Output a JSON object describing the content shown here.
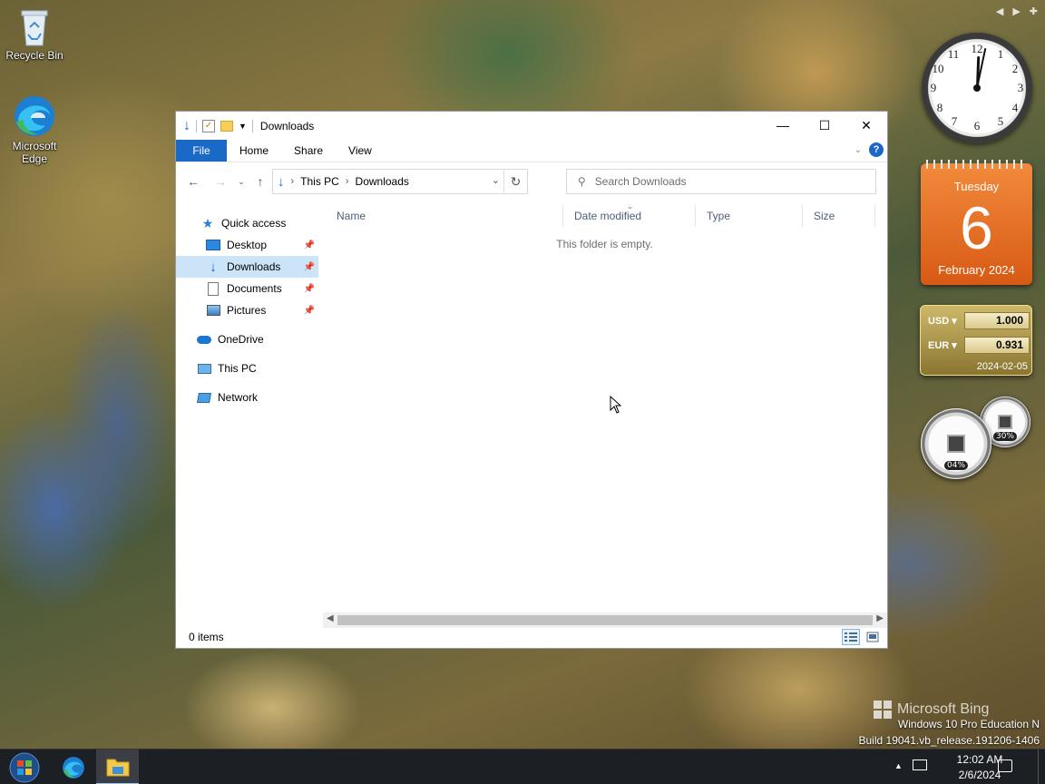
{
  "desktop": {
    "icons": [
      {
        "label": "Recycle Bin",
        "icon": "recycle-bin-icon"
      },
      {
        "label": "Microsoft Edge",
        "icon": "edge-icon"
      }
    ]
  },
  "explorer": {
    "title": "Downloads",
    "ribbon_tabs": [
      "File",
      "Home",
      "Share",
      "View"
    ],
    "address": {
      "crumbs": [
        "This PC",
        "Downloads"
      ]
    },
    "search": {
      "placeholder": "Search Downloads"
    },
    "nav": {
      "quick_access": "Quick access",
      "pinned": [
        "Desktop",
        "Downloads",
        "Documents",
        "Pictures"
      ],
      "onedrive": "OneDrive",
      "this_pc": "This PC",
      "network": "Network",
      "selected": "Downloads"
    },
    "columns": [
      "Name",
      "Date modified",
      "Type",
      "Size"
    ],
    "empty_message": "This folder is empty.",
    "status": "0 items"
  },
  "gadgets": {
    "calendar": {
      "weekday": "Tuesday",
      "day": "6",
      "month_year": "February 2024"
    },
    "currency": {
      "rows": [
        {
          "code": "USD",
          "value": "1.000"
        },
        {
          "code": "EUR",
          "value": "0.931"
        }
      ],
      "date": "2024-02-05"
    },
    "meters": {
      "cpu": "04%",
      "memory": "30%"
    }
  },
  "watermark": {
    "bing": "Microsoft Bing",
    "edition": "Windows 10 Pro Education N",
    "build": "Build 19041.vb_release.191206-1406"
  },
  "taskbar": {
    "time": "12:02 AM",
    "date": "2/6/2024"
  },
  "colors": {
    "accent": "#1a69c7",
    "selection": "#cce4f7",
    "calendar": "#e56d23",
    "taskbar": "#1c1f24"
  }
}
